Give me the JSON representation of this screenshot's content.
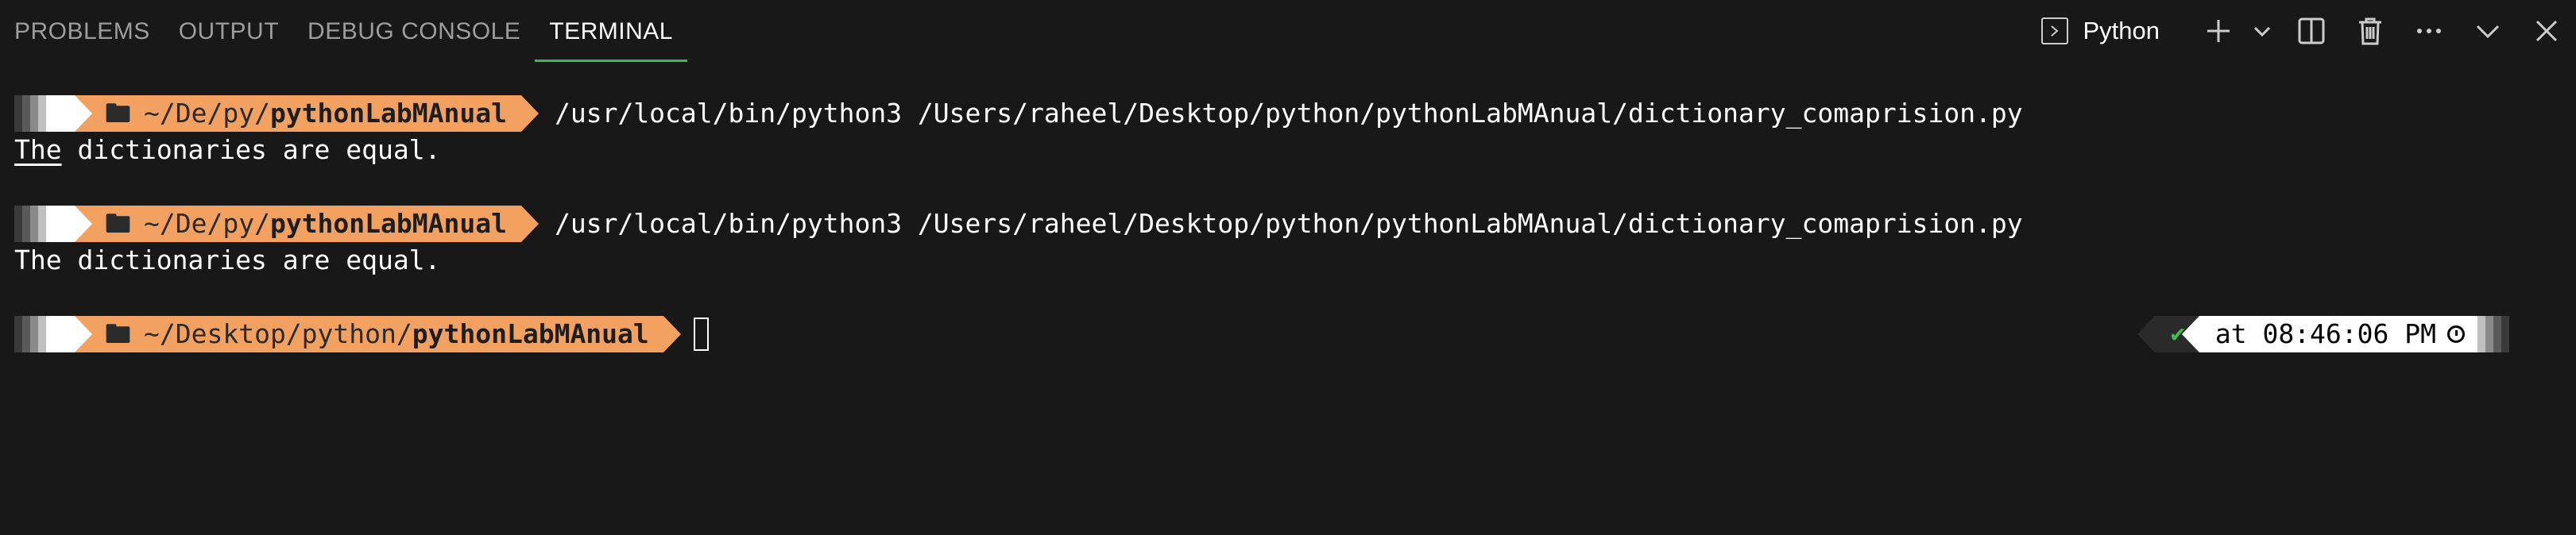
{
  "panel": {
    "tabs": [
      {
        "label": "PROBLEMS"
      },
      {
        "label": "OUTPUT"
      },
      {
        "label": "DEBUG CONSOLE"
      },
      {
        "label": "TERMINAL",
        "active": true
      }
    ],
    "profile_label": "Python",
    "action_icons": [
      "terminal-profile-icon",
      "plus-icon",
      "chevron-down-icon",
      "split-icon",
      "trash-icon",
      "more-icon",
      "chevron-down-icon",
      "close-icon"
    ]
  },
  "terminal": {
    "prompt1": {
      "apple": "",
      "path_dim": "~/De/py/",
      "path_bold": "pythonLabMAnual"
    },
    "cmd1": "/usr/local/bin/python3 /Users/raheel/Desktop/python/pythonLabMAnual/dictionary_comaprision.py",
    "out1_word": "The",
    "out1_rest": " dictionaries are equal.",
    "prompt2": {
      "apple": "",
      "path_dim": "~/De/py/",
      "path_bold": "pythonLabMAnual"
    },
    "cmd2": "/usr/local/bin/python3 /Users/raheel/Desktop/python/pythonLabMAnual/dictionary_comaprision.py",
    "out2": "The dictionaries are equal.",
    "prompt3": {
      "apple": "",
      "path_dim": "~/Desktop/python/",
      "path_bold": "pythonLabMAnual"
    },
    "right_prompt": {
      "status": "✔",
      "time": "at 08:46:06 PM"
    }
  },
  "colors": {
    "background": "#181818",
    "active_tab_underline": "#3fb950",
    "prompt_path_bg": "#f2a160",
    "status_ok": "#3fbf4a"
  }
}
